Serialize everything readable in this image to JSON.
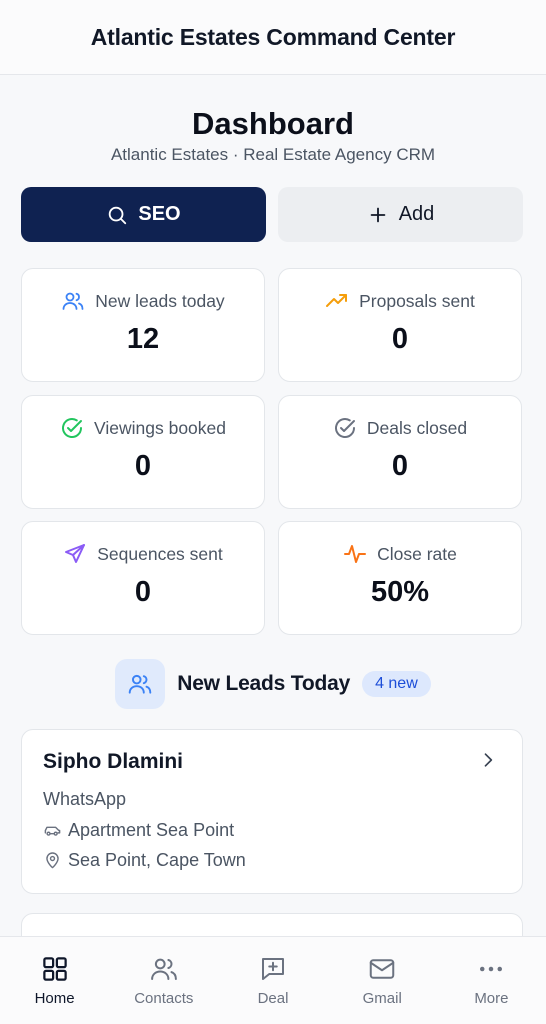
{
  "header": {
    "title": "Atlantic Estates Command Center"
  },
  "page": {
    "title": "Dashboard",
    "subtitle": "Atlantic Estates · Real Estate Agency CRM"
  },
  "actions": {
    "seo_label": "SEO",
    "add_label": "Add"
  },
  "stats": [
    {
      "label": "New leads today",
      "value": "12",
      "icon": "users-icon",
      "color": "#3b82f6"
    },
    {
      "label": "Proposals sent",
      "value": "0",
      "icon": "trending-up-icon",
      "color": "#f59e0b"
    },
    {
      "label": "Viewings booked",
      "value": "0",
      "icon": "check-circle-icon",
      "color": "#22c55e"
    },
    {
      "label": "Deals closed",
      "value": "0",
      "icon": "check-circle-icon",
      "color": "#6b7280"
    },
    {
      "label": "Sequences sent",
      "value": "0",
      "icon": "send-icon",
      "color": "#8b5cf6"
    },
    {
      "label": "Close rate",
      "value": "50%",
      "icon": "activity-icon",
      "color": "#f97316"
    }
  ],
  "leads_section": {
    "title": "New Leads Today",
    "badge": "4 new"
  },
  "leads": [
    {
      "name": "Sipho Dlamini",
      "source": "WhatsApp",
      "property": "Apartment Sea Point",
      "location": "Sea Point, Cape Town"
    }
  ],
  "nav": [
    {
      "label": "Home",
      "icon": "home-grid-icon",
      "active": true
    },
    {
      "label": "Contacts",
      "icon": "users-icon",
      "active": false
    },
    {
      "label": "Deal",
      "icon": "message-plus-icon",
      "active": false
    },
    {
      "label": "Gmail",
      "icon": "mail-icon",
      "active": false
    },
    {
      "label": "More",
      "icon": "more-icon",
      "active": false
    }
  ],
  "colors": {
    "primary": "#0f2251",
    "accent_blue": "#1d4ed8",
    "background": "#f7f8fa"
  }
}
